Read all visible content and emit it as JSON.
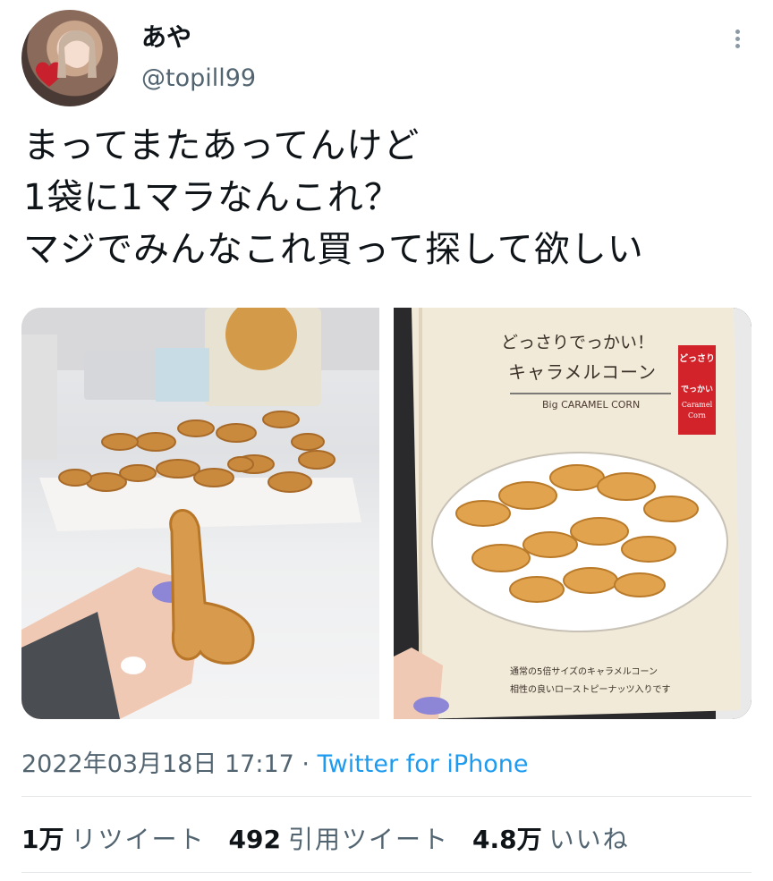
{
  "user": {
    "display_name": "あや",
    "handle": "@topill99"
  },
  "tweet": {
    "lines": [
      "まってまたあってんけど",
      "1袋に1マラなんこれ？",
      "マジでみんなこれ買って探して欲しい"
    ]
  },
  "media": {
    "package_text": {
      "headline": "どっさりでっかい！",
      "product": "キャラメルコーン",
      "english": "Big CARAMEL CORN",
      "badge_top": "どっさり",
      "badge_middle": "でっかい",
      "badge_bottom_1": "Caramel",
      "badge_bottom_2": "Corn",
      "note_1": "通常の5倍サイズのキャラメルコーン",
      "note_2": "相性の良いローストピーナッツ入りです"
    }
  },
  "meta": {
    "timestamp": "2022年03月18日 17:17",
    "separator": "·",
    "source": "Twitter for iPhone"
  },
  "stats": {
    "retweets_count": "1万",
    "retweets_label": "リツイート",
    "quotes_count": "492",
    "quotes_label": "引用ツイート",
    "likes_count": "4.8万",
    "likes_label": "いいね"
  },
  "colors": {
    "link": "#1d9bf0",
    "secondary_text": "#536471",
    "primary_text": "#0f1419"
  },
  "icons": [
    "more-vertical-icon"
  ]
}
